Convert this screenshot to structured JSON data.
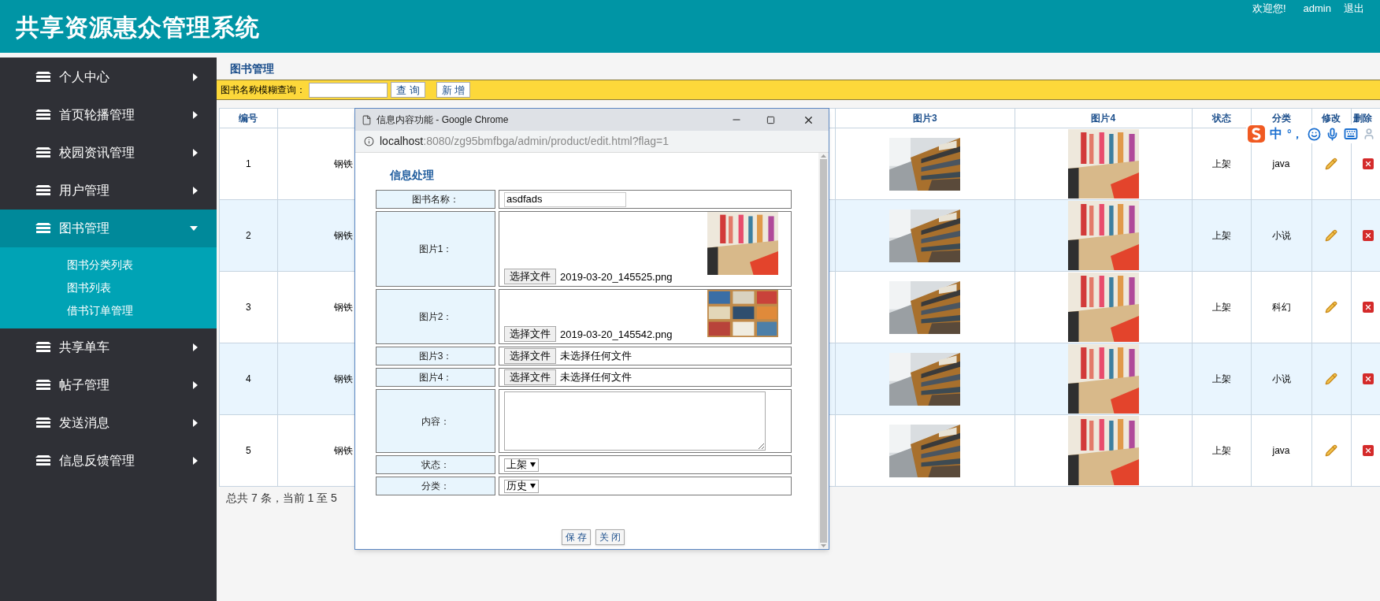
{
  "header": {
    "title": "共享资源惠众管理系统",
    "welcome": "欢迎您!",
    "user": "admin",
    "logout": "退出"
  },
  "sidebar": {
    "items": [
      {
        "label": "个人中心",
        "expanded": false
      },
      {
        "label": "首页轮播管理",
        "expanded": false
      },
      {
        "label": "校园资讯管理",
        "expanded": false
      },
      {
        "label": "用户管理",
        "expanded": false
      },
      {
        "label": "图书管理",
        "expanded": true,
        "children": [
          {
            "label": "图书分类列表"
          },
          {
            "label": "图书列表"
          },
          {
            "label": "借书订单管理"
          }
        ]
      },
      {
        "label": "共享单车",
        "expanded": false
      },
      {
        "label": "帖子管理",
        "expanded": false
      },
      {
        "label": "发送消息",
        "expanded": false
      },
      {
        "label": "信息反馈管理",
        "expanded": false
      }
    ]
  },
  "page_title": "图书管理",
  "search": {
    "label": "图书名称模糊查询：",
    "buttons": [
      "查 询",
      "新 增"
    ]
  },
  "table": {
    "columns": [
      "编号",
      "图片3",
      "图片4",
      "状态",
      "分类",
      "修改",
      "删除"
    ],
    "rows": [
      {
        "id": "1",
        "name": "钢铁",
        "status": "上架",
        "category": "java"
      },
      {
        "id": "2",
        "name": "钢铁",
        "status": "上架",
        "category": "小说"
      },
      {
        "id": "3",
        "name": "钢铁",
        "status": "上架",
        "category": "科幻"
      },
      {
        "id": "4",
        "name": "钢铁",
        "status": "上架",
        "category": "小说"
      },
      {
        "id": "5",
        "name": "钢铁",
        "status": "上架",
        "category": "java"
      }
    ]
  },
  "footer": "总共 7 条，当前 1 至 5",
  "ime": {
    "chars": [
      "中",
      "°，"
    ]
  },
  "dialog": {
    "title": "信息内容功能 - Google Chrome",
    "url_host": "localhost",
    "url_rest": ":8080/zg95bmfbga/admin/product/edit.html?flag=1",
    "heading": "信息处理",
    "fields": [
      {
        "kind": "text",
        "label": "图书名称：",
        "value": "asdfads"
      },
      {
        "kind": "file",
        "label": "图片1：",
        "button": "选择文件",
        "file": "2019-03-20_145525.png",
        "preview": true
      },
      {
        "kind": "file",
        "label": "图片2：",
        "button": "选择文件",
        "file": "2019-03-20_145542.png",
        "preview": true
      },
      {
        "kind": "file",
        "label": "图片3：",
        "button": "选择文件",
        "file": "未选择任何文件",
        "preview": false
      },
      {
        "kind": "file",
        "label": "图片4：",
        "button": "选择文件",
        "file": "未选择任何文件",
        "preview": false
      },
      {
        "kind": "textarea",
        "label": "内容："
      },
      {
        "kind": "select",
        "label": "状态：",
        "value": "上架"
      },
      {
        "kind": "select",
        "label": "分类：",
        "value": "历史"
      }
    ],
    "buttons": [
      "保 存",
      "关 闭"
    ]
  }
}
